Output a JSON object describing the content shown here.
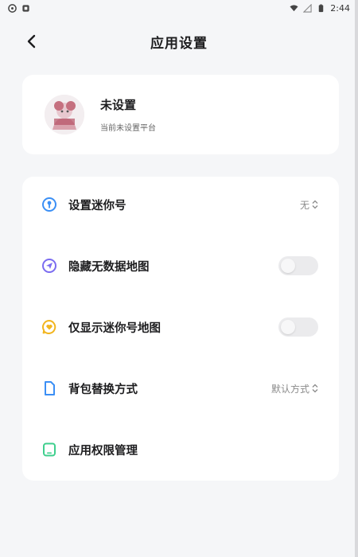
{
  "statusbar": {
    "time": "2:44"
  },
  "header": {
    "title": "应用设置"
  },
  "profile": {
    "name": "未设置",
    "subtitle": "当前未设置平台"
  },
  "settings": {
    "mini_number": {
      "label": "设置迷你号",
      "value": "无"
    },
    "hide_no_data_map": {
      "label": "隐藏无数据地图",
      "enabled": false
    },
    "only_show_mini_map": {
      "label": "仅显示迷你号地图",
      "enabled": false
    },
    "backpack_replace": {
      "label": "背包替换方式",
      "value": "默认方式"
    },
    "app_permissions": {
      "label": "应用权限管理"
    }
  },
  "colors": {
    "accent_blue": "#3b8ff5",
    "accent_purple": "#7b6cf0",
    "accent_yellow": "#f2b51f",
    "accent_green": "#3fcf8e"
  }
}
